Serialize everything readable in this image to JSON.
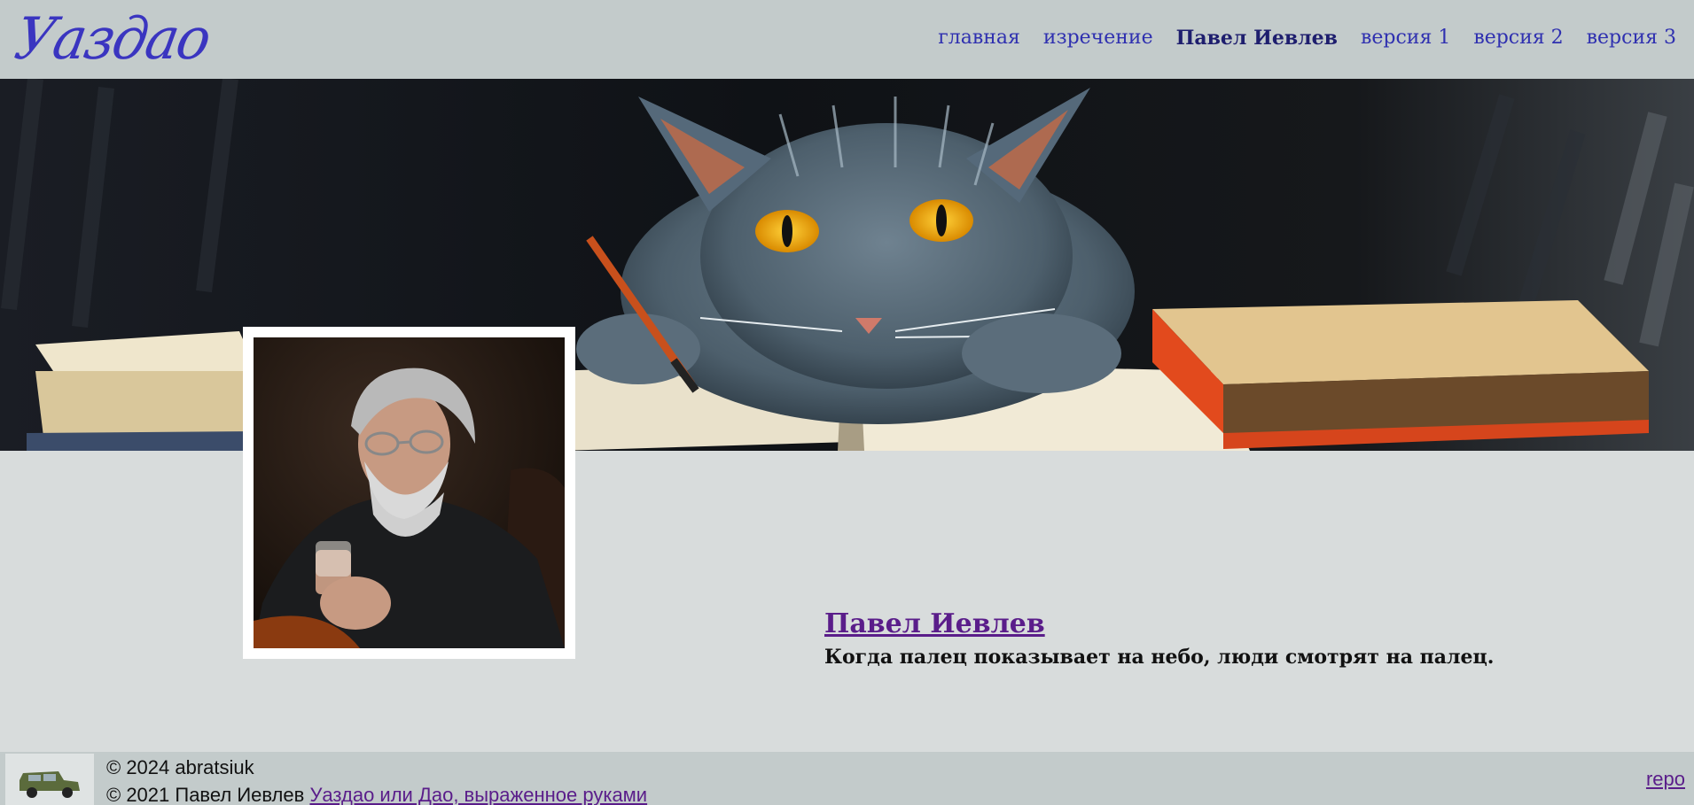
{
  "header": {
    "logo_text": "Уаздао",
    "nav": [
      {
        "label": "главная",
        "active": false
      },
      {
        "label": "изречение",
        "active": false
      },
      {
        "label": "Павел Иевлев",
        "active": true
      },
      {
        "label": "версия 1",
        "active": false
      },
      {
        "label": "версия 2",
        "active": false
      },
      {
        "label": "версия 3",
        "active": false
      }
    ]
  },
  "banner": {
    "image": "cat-with-books-painting"
  },
  "avatar": {
    "image": "portrait-grey-haired-man"
  },
  "main": {
    "author_name": "Павел Иевлев",
    "quote": "Когда палец показывает на небо, люди смотрят на палец."
  },
  "footer": {
    "car_icon": "car-icon",
    "copyright_2024": "© 2024 abratsiuk",
    "copyright_2021_prefix": "© 2021 Павел Иевлев",
    "book_link": "Уаздао или Дао, выраженное руками",
    "repo_link": "repo"
  },
  "colors": {
    "header_bg": "#c3cbcb",
    "page_bg": "#d8dcdc",
    "nav_link": "#2f30b0",
    "visited_link": "#5a1d8a"
  }
}
